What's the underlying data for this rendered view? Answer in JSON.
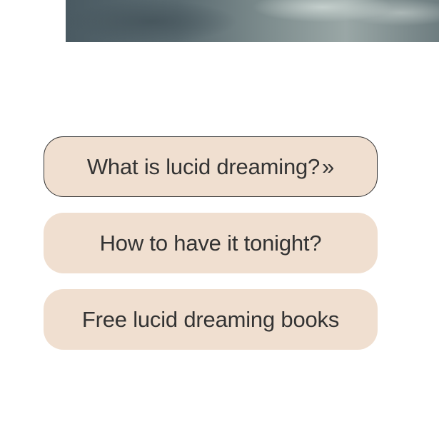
{
  "menu": {
    "items": [
      {
        "label": "What is lucid dreaming?",
        "suffix": "»"
      },
      {
        "label": "How to have it tonight?"
      },
      {
        "label": "Free lucid dreaming books"
      }
    ]
  }
}
